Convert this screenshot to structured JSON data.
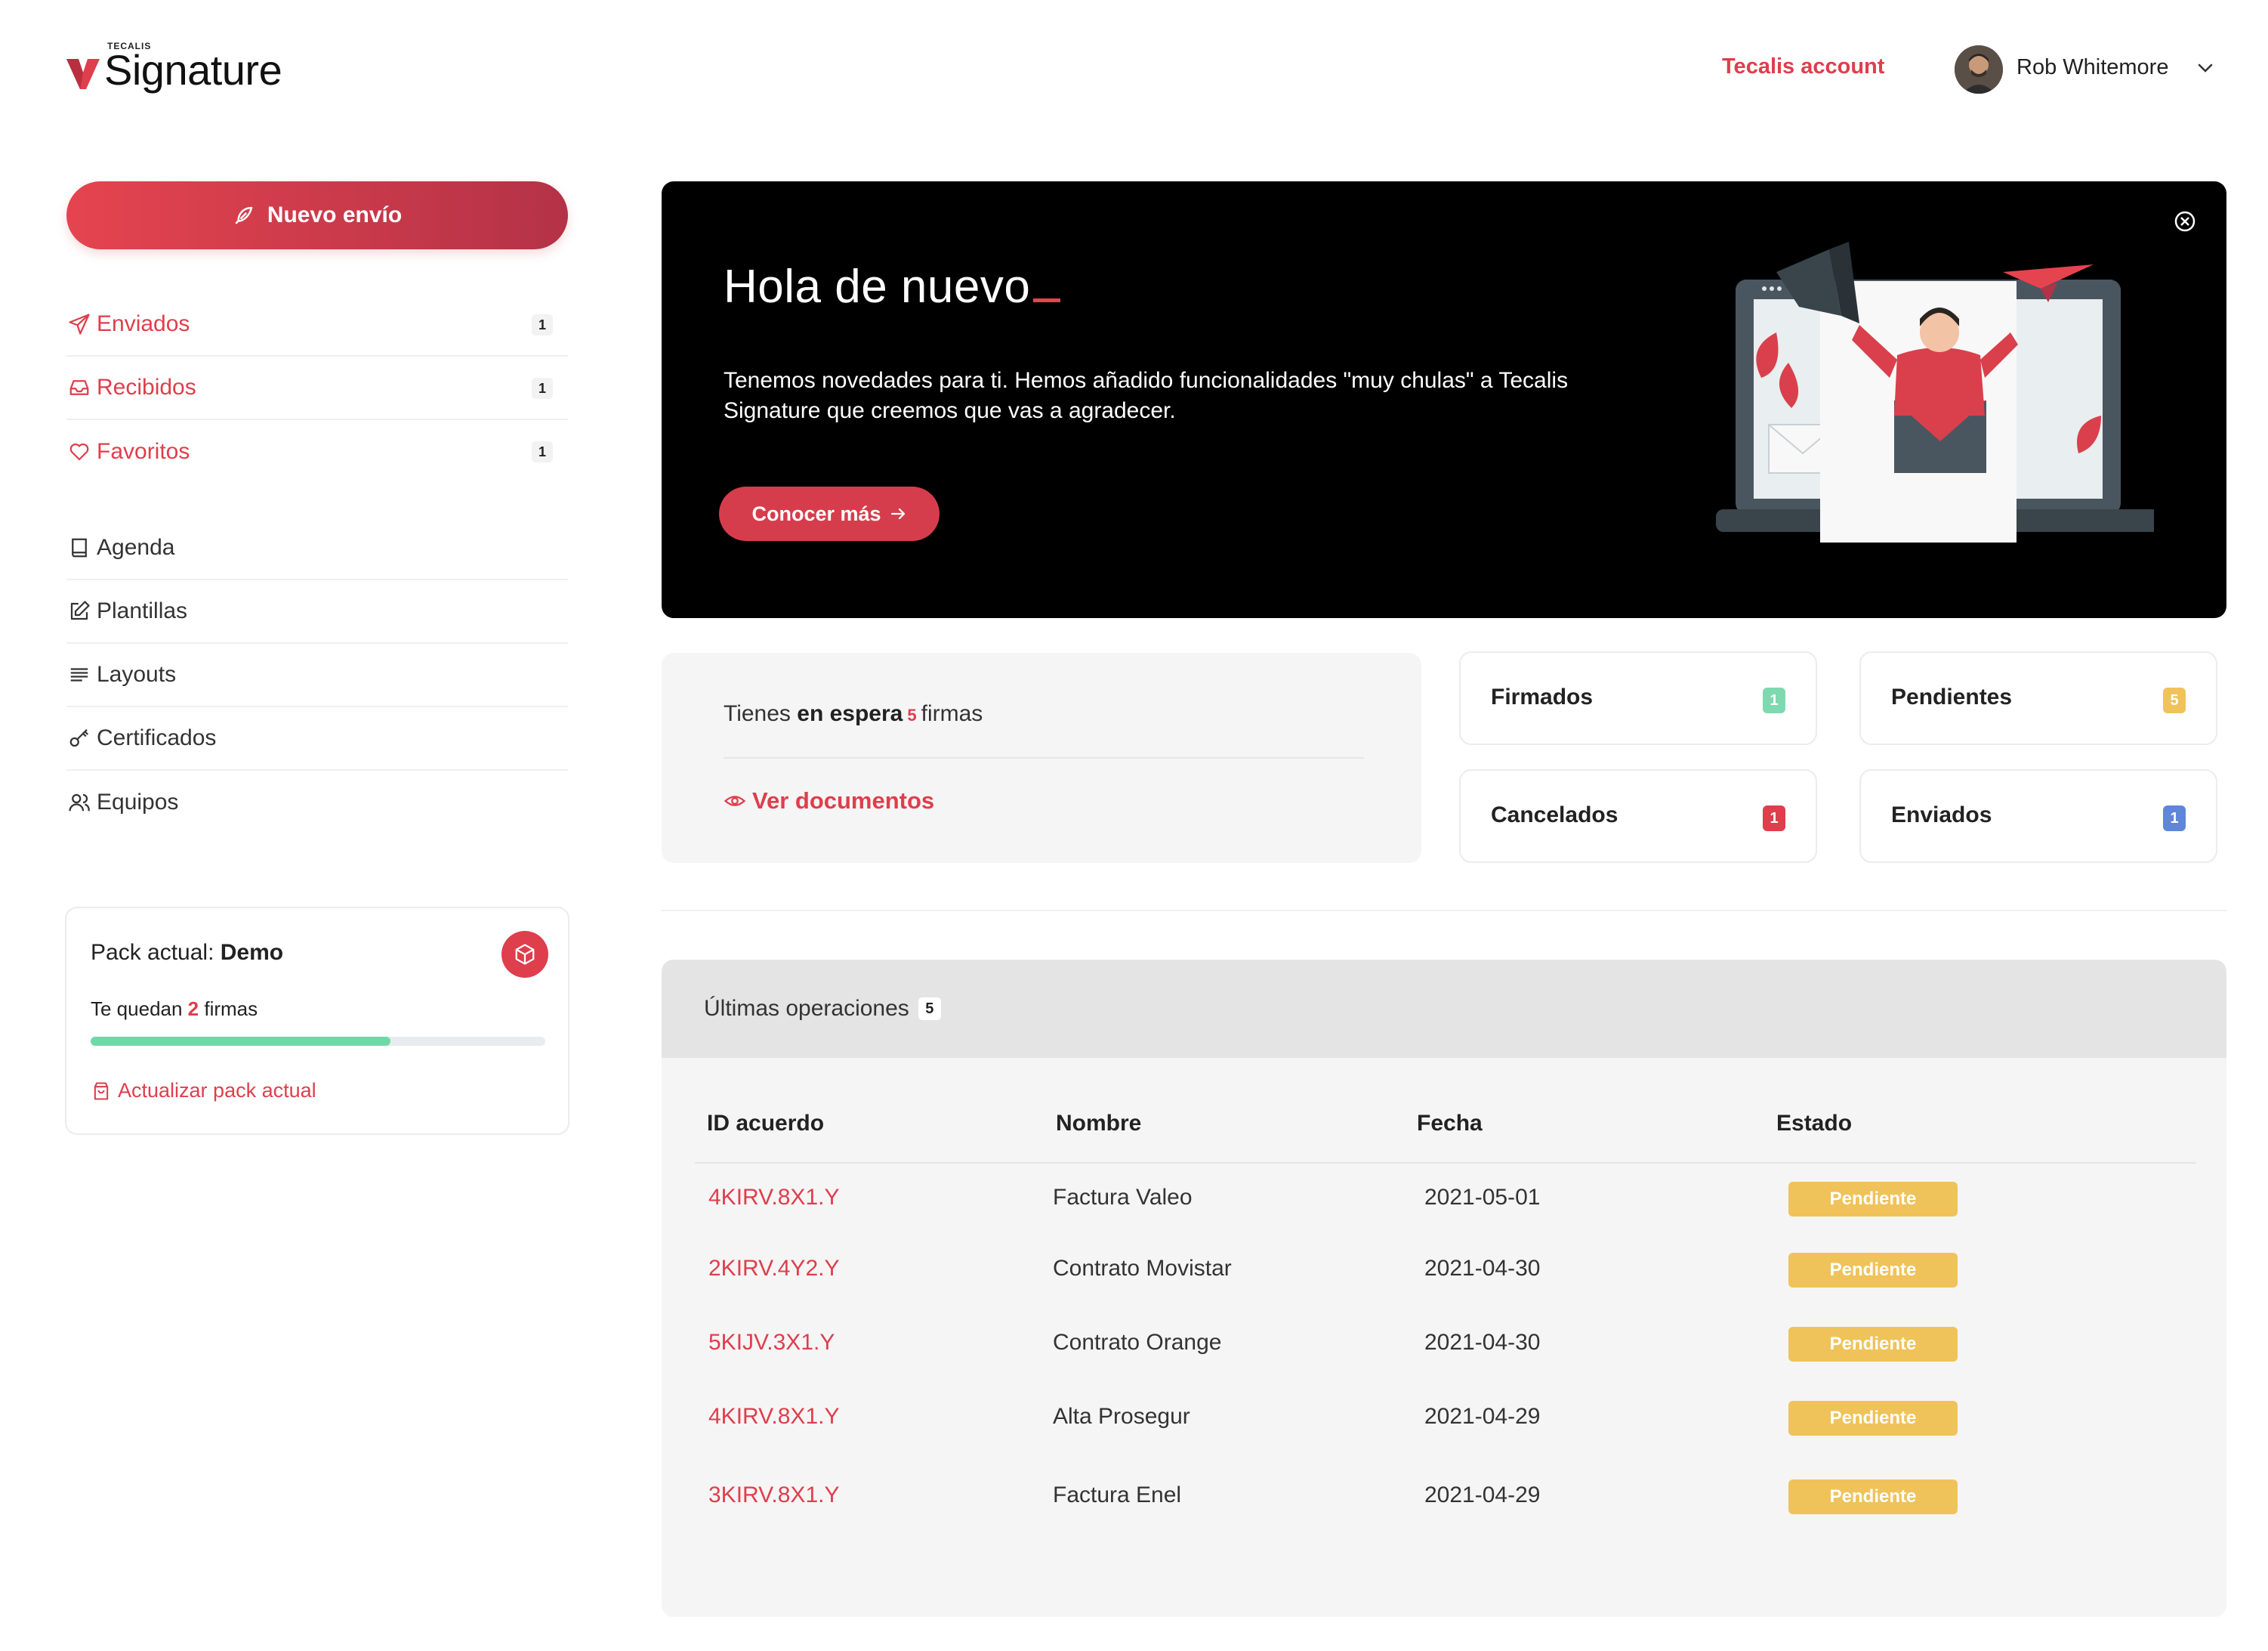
{
  "brand": {
    "small": "TECALIS",
    "name": "Signature"
  },
  "header": {
    "account_link": "Tecalis account",
    "user_name": "Rob Whitemore"
  },
  "sidebar": {
    "new_button": "Nuevo envío",
    "primary": [
      {
        "label": "Enviados",
        "count": "1",
        "icon": "send-icon"
      },
      {
        "label": "Recibidos",
        "count": "1",
        "icon": "inbox-icon"
      },
      {
        "label": "Favoritos",
        "count": "1",
        "icon": "heart-icon"
      }
    ],
    "secondary": [
      {
        "label": "Agenda",
        "icon": "book-icon"
      },
      {
        "label": "Plantillas",
        "icon": "edit-icon"
      },
      {
        "label": "Layouts",
        "icon": "lines-icon"
      },
      {
        "label": "Certificados",
        "icon": "key-icon"
      },
      {
        "label": "Equipos",
        "icon": "users-icon"
      }
    ],
    "pack": {
      "title_prefix": "Pack actual: ",
      "title_value": "Demo",
      "remaining_prefix": "Te quedan ",
      "remaining_count": "2",
      "remaining_suffix": " firmas",
      "progress_percent": 66,
      "update_link": "Actualizar pack actual"
    }
  },
  "banner": {
    "title": "Hola de nuevo",
    "text": "Tenemos novedades para ti. Hemos añadido funcionalidades \"muy chulas\" a Tecalis Signature que creemos que vas a agradecer.",
    "button": "Conocer más"
  },
  "waiting": {
    "prefix": "Tienes ",
    "bold": "en espera",
    "count": "5",
    "suffix": "firmas",
    "link": "Ver documentos"
  },
  "stats": [
    {
      "label": "Firmados",
      "count": "1",
      "color": "#7fd9b0"
    },
    {
      "label": "Pendientes",
      "count": "5",
      "color": "#efc35a"
    },
    {
      "label": "Cancelados",
      "count": "1",
      "color": "#df3e4c"
    },
    {
      "label": "Enviados",
      "count": "1",
      "color": "#5f86d8"
    }
  ],
  "operations": {
    "title": "Últimas operaciones",
    "count": "5",
    "columns": [
      "ID acuerdo",
      "Nombre",
      "Fecha",
      "Estado"
    ],
    "rows": [
      {
        "id": "4KIRV.8X1.Y",
        "name": "Factura Valeo",
        "date": "2021-05-01",
        "state": "Pendiente"
      },
      {
        "id": "2KIRV.4Y2.Y",
        "name": "Contrato Movistar",
        "date": "2021-04-30",
        "state": "Pendiente"
      },
      {
        "id": "5KIJV.3X1.Y",
        "name": "Contrato Orange",
        "date": "2021-04-30",
        "state": "Pendiente"
      },
      {
        "id": "4KIRV.8X1.Y",
        "name": "Alta Prosegur",
        "date": "2021-04-29",
        "state": "Pendiente"
      },
      {
        "id": "3KIRV.8X1.Y",
        "name": "Factura Enel",
        "date": "2021-04-29",
        "state": "Pendiente"
      }
    ]
  },
  "colors": {
    "accent": "#df3e4c",
    "pending": "#efc35a",
    "progress": "#6fd8a7"
  }
}
